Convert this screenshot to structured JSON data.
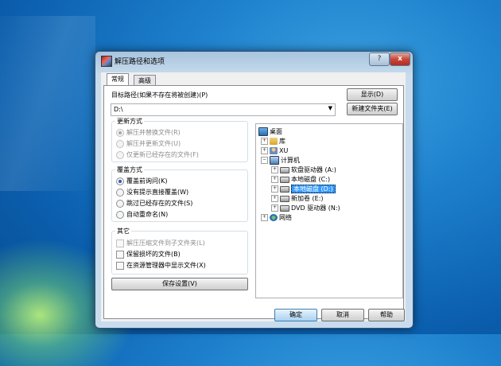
{
  "window": {
    "title": "解压路径和选项",
    "help_label": "?",
    "close_label": "x"
  },
  "tabs": [
    {
      "label": "常规"
    },
    {
      "label": "高级"
    }
  ],
  "target": {
    "label": "目标路径(如果不存在将被创建)(P)",
    "value": "D:\\",
    "show_button": "显示(D)",
    "new_folder_button": "新建文件夹(E)"
  },
  "update_mode": {
    "title": "更新方式",
    "options": [
      "解压并替换文件(R)",
      "解压并更新文件(U)",
      "仅更新已经存在的文件(F)"
    ],
    "selected": 0,
    "disabled": true
  },
  "overwrite_mode": {
    "title": "覆盖方式",
    "options": [
      "覆盖前询问(K)",
      "没有提示直接覆盖(W)",
      "跳过已经存在的文件(S)",
      "自动重命名(N)"
    ],
    "selected": 0
  },
  "misc": {
    "title": "其它",
    "options": [
      "解压压缩文件到子文件夹(L)",
      "保留损坏的文件(B)",
      "在资源管理器中显示文件(X)"
    ]
  },
  "save_button": "保存设置(V)",
  "tree": {
    "items": [
      {
        "label": "桌面",
        "icon": "desktop-icon",
        "expander": ""
      },
      {
        "label": "库",
        "icon": "library-icon",
        "expander": "+"
      },
      {
        "label": "XU",
        "icon": "user-icon",
        "expander": "+"
      },
      {
        "label": "计算机",
        "icon": "computer-icon",
        "expander": "−"
      },
      {
        "label": "软盘驱动器 (A:)",
        "icon": "floppy-drive-icon",
        "expander": "+"
      },
      {
        "label": "本地磁盘 (C:)",
        "icon": "local-disk-icon",
        "expander": "+"
      },
      {
        "label": "本地磁盘 (D:)",
        "icon": "local-disk-icon",
        "expander": "+",
        "selected": true
      },
      {
        "label": "新加卷 (E:)",
        "icon": "volume-icon",
        "expander": "+"
      },
      {
        "label": "DVD 驱动器 (N:)",
        "icon": "dvd-drive-icon",
        "expander": "+"
      },
      {
        "label": "网络",
        "icon": "network-icon",
        "expander": "+"
      }
    ]
  },
  "footer": {
    "ok": "确定",
    "cancel": "取消",
    "help": "帮助"
  }
}
